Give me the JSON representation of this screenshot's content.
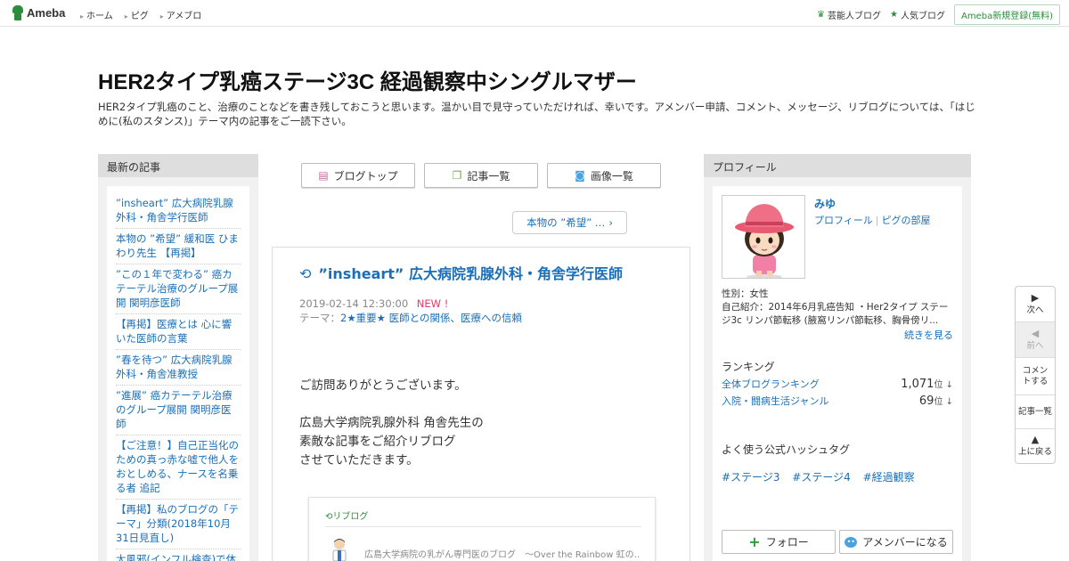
{
  "topbar": {
    "logo": "Ameba",
    "nav": [
      "ホーム",
      "ピグ",
      "アメブロ"
    ],
    "celebrity_blog": "芸能人ブログ",
    "popular_blog": "人気ブログ",
    "register": "Ameba新規登録(無料)"
  },
  "header": {
    "title": "HER2タイプ乳癌ステージ3C 経過観察中シングルマザー",
    "description": "HER2タイプ乳癌のこと、治療のことなどを書き残しておこうと思います。温かい目で見守っていただければ、幸いです。アメンバー申請、コメント、メッセージ、リブログについては、「はじめに(私のスタンス)」テーマ内の記事をご一読下さい。"
  },
  "recent": {
    "heading": "最新の記事",
    "items": [
      "”insheart” 広大病院乳腺外科・角舎学行医師",
      "本物の ”希望” 緩和医 ひまわり先生 【再掲】",
      "”この１年で変わる” 癌カテーテル治療のグループ展開 関明彦医師",
      "【再掲】医療とは 心に響いた医師の言葉",
      "”春を待つ” 広大病院乳腺外科・角舎准教授",
      "”進展” 癌カテーテル治療のグループ展開 関明彦医師",
      "【ご注意！】自己正当化のための真っ赤な嘘で他人をおとしめる、ナースを名乗る者 追記",
      "【再掲】私のブログの「テーマ」分類(2018年10月31日見直し)",
      "大風邪(インフル検査)で休"
    ]
  },
  "center": {
    "btn_top": "ブログトップ",
    "btn_list": "記事一覧",
    "btn_images": "画像一覧",
    "next_link": "本物の ”希望” …",
    "article": {
      "title": "”insheart” 広大病院乳腺外科・角舎学行医師",
      "date": "2019-02-14 12:30:00",
      "new_badge": "NEW !",
      "theme_label": "テーマ：",
      "theme": "2★重要★ 医師との関係、医療への信頼",
      "body": [
        "ご訪問ありがとうございます。",
        "広島大学病院乳腺外科 角舎先生の",
        "素敵な記事をご紹介リブログ",
        "させていただきます。"
      ],
      "reblog_label": "リブログ",
      "reblog_source": "広島大学病院の乳がん専門医のブログ　～Over the Rainbow 虹の…"
    }
  },
  "profile": {
    "heading": "プロフィール",
    "name": "みゆ",
    "link_profile": "プロフィール",
    "link_pigg": "ピグの部屋",
    "gender": "性別：女性",
    "intro": "自己紹介：2014年6月乳癌告知 ・Her2タイプ ステージ3c リンパ節転移 (腋窩リンパ節転移、胸骨傍リ...",
    "more": "続きを見る",
    "ranking_heading": "ランキング",
    "ranking": [
      {
        "label": "全体ブログランキング",
        "value": "1,071",
        "unit": "位 ↓"
      },
      {
        "label": "入院・闘病生活ジャンル",
        "value": "69",
        "unit": "位 ↓"
      }
    ],
    "tags_heading": "よく使う公式ハッシュタグ",
    "tags": [
      "#ステージ3",
      "#ステージ4",
      "#経過観察"
    ],
    "follow": "フォロー",
    "member": "アメンバーになる"
  },
  "sidenav": {
    "next": "次へ",
    "prev": "前へ",
    "comment": "コメントする",
    "list": "記事一覧",
    "top": "上に戻る"
  },
  "colors": {
    "brand_green": "#2d8c3c",
    "link_blue": "#1a6fb8",
    "new_pink": "#e8386d"
  }
}
